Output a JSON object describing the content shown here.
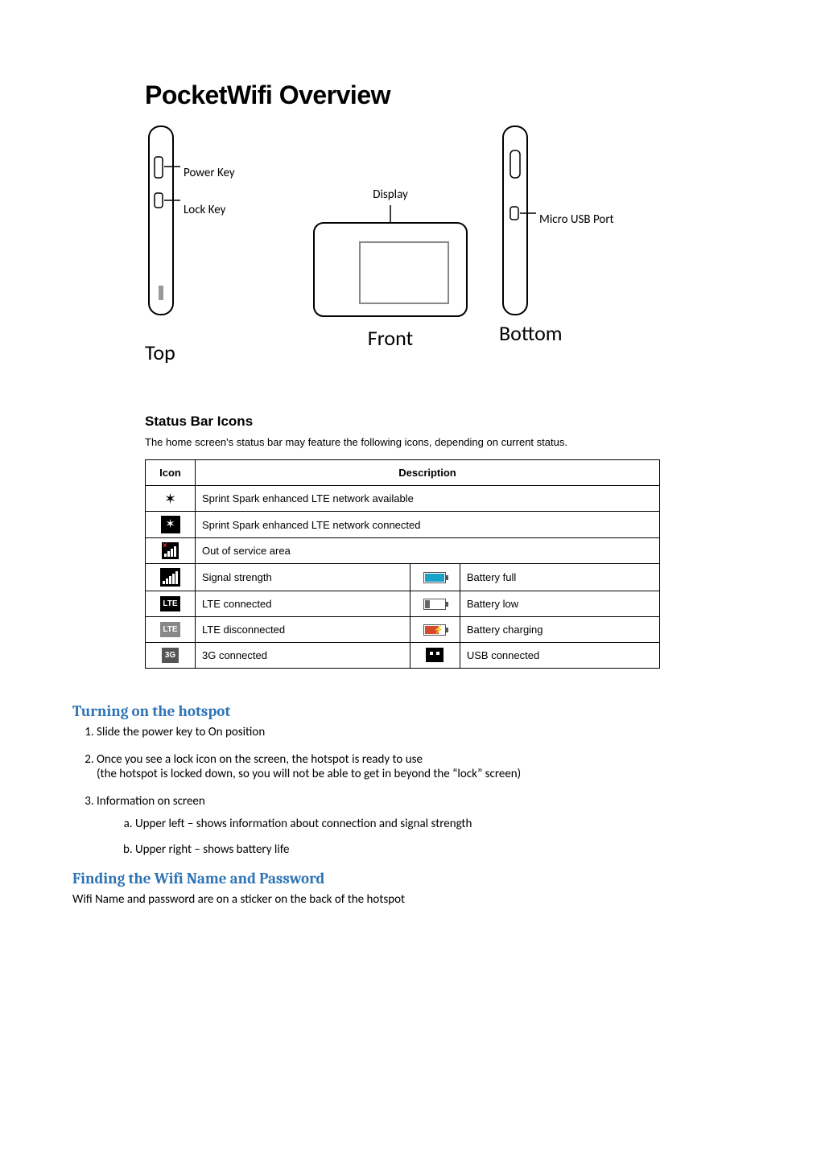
{
  "title": "PocketWifi Overview",
  "diagram": {
    "power_key": "Power Key",
    "lock_key": "Lock Key",
    "display": "Display",
    "micro_usb": "Micro USB Port",
    "top": "Top",
    "front": "Front",
    "bottom": "Bottom"
  },
  "status": {
    "heading": "Status Bar Icons",
    "intro": "The home screen's status bar may feature the following icons, depending on current status.",
    "col_icon": "Icon",
    "col_desc": "Description",
    "rows_full": [
      "Sprint Spark enhanced LTE network available",
      "Sprint Spark enhanced LTE network connected",
      "Out of service area"
    ],
    "rows_pair": [
      {
        "left": "Signal strength",
        "right": "Battery full"
      },
      {
        "left": "LTE connected",
        "right": "Battery low"
      },
      {
        "left": "LTE disconnected",
        "right": "Battery charging"
      },
      {
        "left": "3G connected",
        "right": "USB connected"
      }
    ]
  },
  "turning": {
    "heading": "Turning on the hotspot",
    "step1": "Slide the power key to On position",
    "step2a": "Once you see a lock icon on the screen, the hotspot is ready to use",
    "step2b": "(the hotspot is locked down, so you will not be able to get in beyond the “lock” screen)",
    "step3": "Information on screen",
    "sub_a": "Upper left – shows information about connection and signal strength",
    "sub_b": "Upper right – shows battery life"
  },
  "finding": {
    "heading": "Finding the Wifi Name and Password",
    "body": "Wifi Name and password are on a sticker on the back of the hotspot"
  }
}
